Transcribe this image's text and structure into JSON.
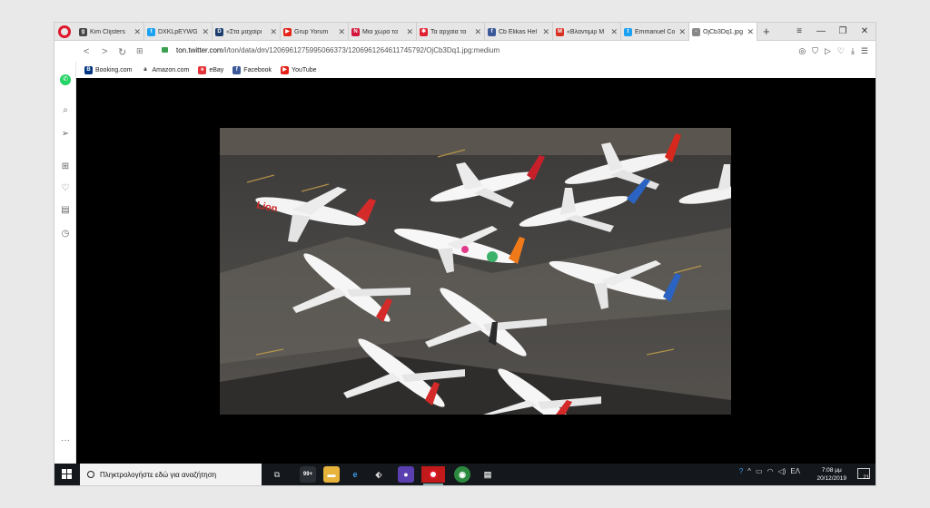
{
  "tabs": [
    {
      "title": "Kim Clijsters",
      "favicon": "g-icon",
      "color": "#444444",
      "glyph": "g"
    },
    {
      "title": "DXKLpEYWG",
      "favicon": "twitter-icon",
      "color": "#1da1f2",
      "glyph": "t"
    },
    {
      "title": "«Στα μαχαίρι",
      "favicon": "d-icon",
      "color": "#1c3d6e",
      "glyph": "D"
    },
    {
      "title": "Grup Yorum",
      "favicon": "youtube-icon",
      "color": "#e62117",
      "glyph": "▶"
    },
    {
      "title": "Μια χώρα τα",
      "favicon": "news-icon",
      "color": "#d4143a",
      "glyph": "N"
    },
    {
      "title": "Τα αρχαία τα",
      "favicon": "star-icon",
      "color": "#e02030",
      "glyph": "✱"
    },
    {
      "title": "Cb Elikas Hel",
      "favicon": "facebook-icon",
      "color": "#3b5998",
      "glyph": "f"
    },
    {
      "title": "«Βλαντιμίρ Μ",
      "favicon": "gmail-icon",
      "color": "#d93025",
      "glyph": "M"
    },
    {
      "title": "Emmanuel Co",
      "favicon": "twitter-icon",
      "color": "#1da1f2",
      "glyph": "t"
    },
    {
      "title": "OjCb3Dq1.jpg",
      "favicon": "image-icon",
      "color": "#888888",
      "glyph": "▫",
      "active": true
    }
  ],
  "address": {
    "domain": "ton.twitter.com",
    "path": "/i/ton/data/dm/1206961275995066373/1206961264611745792/OjCb3Dq1.jpg:medium"
  },
  "bookmarks": [
    {
      "label": "Booking.com",
      "icon": "booking-icon",
      "color": "#003580",
      "glyph": "B"
    },
    {
      "label": "Amazon.com",
      "icon": "amazon-icon",
      "color": "#ffffff",
      "glyph": "a"
    },
    {
      "label": "eBay",
      "icon": "ebay-icon",
      "color": "#e53238",
      "glyph": "e"
    },
    {
      "label": "Facebook",
      "icon": "facebook-icon",
      "color": "#3b5998",
      "glyph": "f"
    },
    {
      "label": "YouTube",
      "icon": "youtube-icon",
      "color": "#e62117",
      "glyph": "▶"
    }
  ],
  "taskbar": {
    "search_placeholder": "Πληκτρολογήστε εδώ για αναζήτηση",
    "lang": "ΕΛ",
    "time": "7:08 μμ",
    "date": "20/12/2019",
    "notifications": "21",
    "store_badge": "99+"
  },
  "colors": {
    "opera_red": "#e0162b",
    "taskbar": "#14171c",
    "tarmac": "#4c4a48"
  }
}
